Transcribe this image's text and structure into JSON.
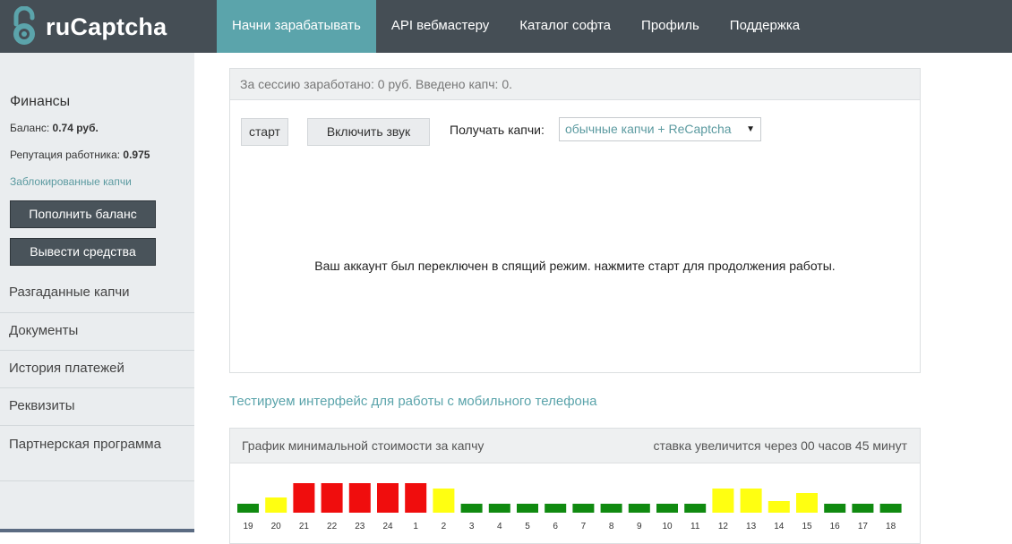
{
  "header": {
    "logo_text": "ruCaptcha",
    "nav": [
      {
        "label": "Начни зарабатывать",
        "active": true
      },
      {
        "label": "API вебмастеру"
      },
      {
        "label": "Каталог софта"
      },
      {
        "label": "Профиль"
      },
      {
        "label": "Поддержка"
      }
    ]
  },
  "sidebar": {
    "finance_title": "Финансы",
    "balance_label": "Баланс:",
    "balance_value": "0.74 руб.",
    "reputation_label": "Репутация работника:",
    "reputation_value": "0.975",
    "blocked_link": "Заблокированные капчи",
    "topup_button": "Пополнить баланс",
    "withdraw_button": "Вывести средства",
    "menu": [
      "Разгаданные капчи",
      "Документы",
      "История платежей",
      "Реквизиты",
      "Партнерская программа"
    ]
  },
  "work_panel": {
    "session_info": "За сессию заработано: 0 руб. Введено капч: 0.",
    "start_button": "старт",
    "sound_button": "Включить звук",
    "receive_label": "Получать капчи:",
    "receive_selected": "обычные капчи + ReCaptcha",
    "sleep_message": "Ваш аккаунт был переключен в спящий режим. нажмите старт для продолжения работы."
  },
  "mobile_link": "Тестируем интерфейс для работы с мобильного телефона",
  "chart_panel": {
    "title": "График минимальной стоимости за капчу",
    "status": "ставка увеличится через 00 часов 45 минут"
  },
  "colors": {
    "green": "#108a10",
    "yellow": "#ffff11",
    "red": "#f00d0d",
    "accent": "#5ba4ab",
    "topbar": "#454e55"
  },
  "chart_data": {
    "type": "bar",
    "categories": [
      "19",
      "20",
      "21",
      "22",
      "23",
      "24",
      "1",
      "2",
      "3",
      "4",
      "5",
      "6",
      "7",
      "8",
      "9",
      "10",
      "11",
      "12",
      "13",
      "14",
      "15",
      "16",
      "17",
      "18"
    ],
    "values": [
      1,
      1.7,
      3.3,
      3.3,
      3.3,
      3.3,
      3.3,
      2.7,
      1,
      1,
      1,
      1,
      1,
      1,
      1,
      1,
      1,
      2.7,
      2.7,
      1.3,
      2.2,
      1,
      1,
      1
    ],
    "colors": [
      "green",
      "yellow",
      "red",
      "red",
      "red",
      "red",
      "red",
      "yellow",
      "green",
      "green",
      "green",
      "green",
      "green",
      "green",
      "green",
      "green",
      "green",
      "yellow",
      "yellow",
      "yellow",
      "yellow",
      "green",
      "green",
      "green"
    ],
    "ylim": [
      0,
      3.3
    ]
  }
}
